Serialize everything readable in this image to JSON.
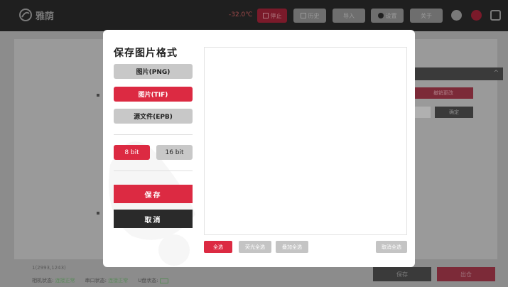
{
  "app": {
    "name": "雅荫"
  },
  "topbar": {
    "temperature": "-32.0℃",
    "stop_label": "停止",
    "history_label": "历史",
    "import_label": "导入",
    "settings_label": "设置",
    "about_label": "关于"
  },
  "background": {
    "coord_text": "1(2993,1243)",
    "camera_status_label": "相机状态:",
    "camera_status_value": "连接正常",
    "serial_status_label": "串口状态:",
    "serial_status_value": "连接正常",
    "usb_status_label": "U盘状态:",
    "restore_label": "撤销更改",
    "confirm_label": "确定",
    "save_label": "保存",
    "exit_label": "出仓"
  },
  "modal": {
    "title": "保存图片格式",
    "formats": [
      {
        "label": "图片(PNG)",
        "selected": false
      },
      {
        "label": "图片(TIF)",
        "selected": true
      },
      {
        "label": "源文件(EPB)",
        "selected": false
      }
    ],
    "bit_depths": [
      {
        "label": "8 bit",
        "selected": true
      },
      {
        "label": "16 bit",
        "selected": false
      }
    ],
    "save_label": "保存",
    "cancel_label": "取消",
    "select_all_label": "全选",
    "fluorescence_select_all_label": "荧光全选",
    "overlay_select_all_label": "叠加全选",
    "deselect_all_label": "取消全选"
  },
  "colors": {
    "accent": "#dc2a42",
    "dark": "#2a2a2a",
    "topbar": "#1f1f1f"
  }
}
